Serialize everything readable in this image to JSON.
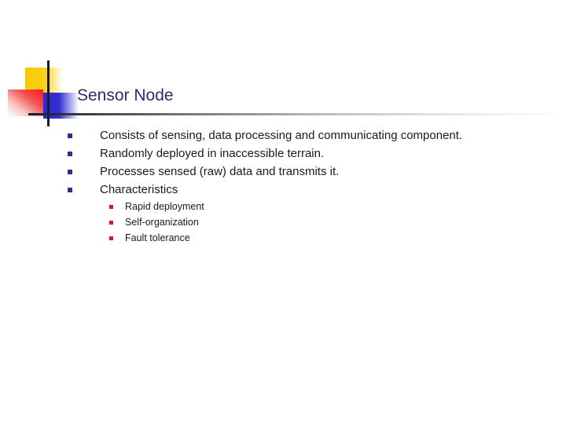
{
  "slide": {
    "title": "Sensor Node",
    "colors": {
      "title": "#2b2b6e",
      "bullet_marker": "#2e2e8a",
      "sub_bullet_marker": "#cc1f1f",
      "deco_yellow": "#f8c800",
      "deco_blue": "#2a2ad0",
      "deco_red": "#ff1a1a"
    },
    "bullets": [
      {
        "text": "Consists of sensing, data processing and communicating component."
      },
      {
        "text": "Randomly deployed in inaccessible terrain."
      },
      {
        "text": "Processes sensed (raw) data and transmits it."
      },
      {
        "text": "Characteristics"
      }
    ],
    "sub_bullets": [
      {
        "text": "Rapid deployment"
      },
      {
        "text": "Self-organization"
      },
      {
        "text": "Fault tolerance"
      }
    ]
  }
}
